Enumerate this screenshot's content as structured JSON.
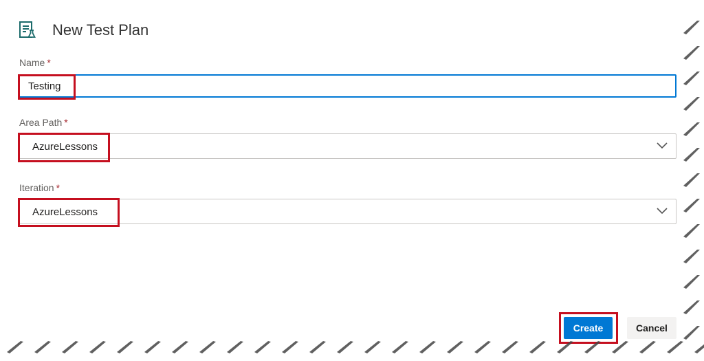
{
  "dialog": {
    "title": "New Test Plan",
    "title_icon": "test-plan-icon"
  },
  "fields": {
    "name": {
      "label": "Name",
      "required_mark": "*",
      "value": "Testing"
    },
    "area_path": {
      "label": "Area Path",
      "required_mark": "*",
      "value": "AzureLessons",
      "icon": "chevron-down-icon"
    },
    "iteration": {
      "label": "Iteration",
      "required_mark": "*",
      "value": "AzureLessons",
      "icon": "chevron-down-icon"
    }
  },
  "footer": {
    "create_label": "Create",
    "cancel_label": "Cancel"
  },
  "colors": {
    "primary": "#0078d4",
    "required": "#a4262c",
    "highlight": "#c50f1f"
  }
}
